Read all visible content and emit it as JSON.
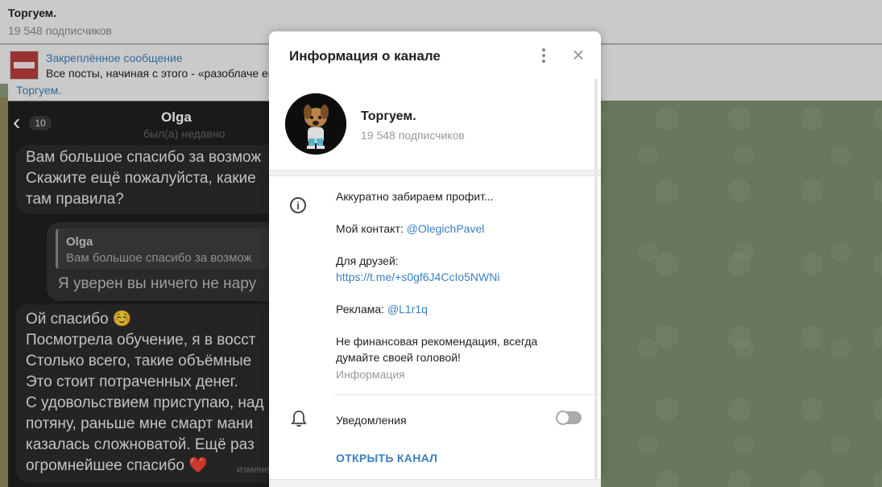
{
  "header": {
    "title": "Торгуем.",
    "subscribers": "19 548 подписчиков"
  },
  "pinned": {
    "label": "Закреплённое сообщение",
    "text": "Все посты, начиная с этого - «разоблаче                                                                         емия. Сделал концепцию детективного фильма, ..."
  },
  "channel_tag": "Торгуем.",
  "chat": {
    "back_count": "10",
    "contact_name": "Olga",
    "contact_status": "был(а) недавно",
    "message1": "Вам большое спасибо за возмож\nСкажите ещё пожалуйста, какие\nтам правила?",
    "reply_quote_name": "Olga",
    "reply_quote_text": "Вам большое спасибо за возмож",
    "reply_text": "Я уверен вы ничего не нару",
    "message2": "Ой спасибо ☺️\nПосмотрела обучение, я в восст\nСтолько всего, такие объёмные\nЭто стоит потраченных денег.\nС удовольствием приступаю, над\nпотяну, раньше мне смарт мани\nказалась сложноватой. Ещё раз\nогромнейшее спасибо ❤️",
    "edited": "измене"
  },
  "modal": {
    "title": "Информация о канале",
    "channel_name": "Торгуем.",
    "channel_subscribers": "19 548 подписчиков",
    "desc_line1": "Аккуратно забираем профит...",
    "contact_label": "Мой контакт:",
    "contact_link": "@OlegichPavel",
    "friends_label": "Для друзей:",
    "friends_link": "https://t.me/+s0gf6J4CcIo5NWNi",
    "ads_label": "Реклама:",
    "ads_link": "@L1r1q",
    "disclaimer_line1": "Не финансовая рекомендация, всегда",
    "disclaimer_line2": "думайте своей головой!",
    "info_caption": "Информация",
    "notifications_label": "Уведомления",
    "notifications_enabled": false,
    "open_channel": "ОТКРЫТЬ КАНАЛ"
  },
  "colors": {
    "accent": "#3a7fbf",
    "chat_bg": "#7d8f6e"
  }
}
